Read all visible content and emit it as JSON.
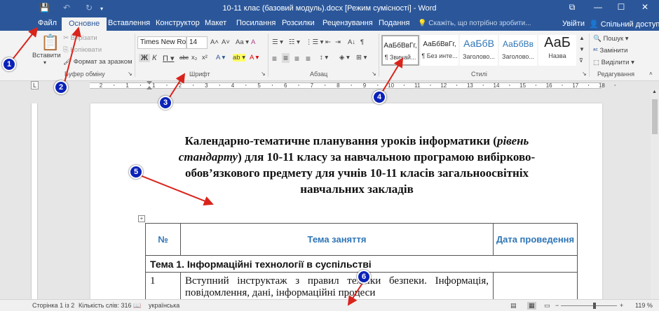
{
  "titlebar": {
    "title": "10-11 клас (базовий модуль).docx [Режим сумісності] - Word",
    "qat": [
      "💾",
      "↶",
      "↻"
    ],
    "window_buttons": [
      "⧉",
      "—",
      "☐",
      "✕"
    ]
  },
  "tabs": {
    "items": [
      "Файл",
      "Основне",
      "Вставлення",
      "Конструктор",
      "Макет",
      "Посилання",
      "Розсилки",
      "Рецензування",
      "Подання"
    ],
    "active": "Основне",
    "tell_me": "Скажіть, що потрібно зробити...",
    "signin": "Увійти",
    "share": "Спільний доступ"
  },
  "clipboard": {
    "paste": "Вставити",
    "cut": "Вирізати",
    "copy": "Копіювати",
    "format_painter": "Формат за зразком",
    "label": "Буфер обміну"
  },
  "font": {
    "name": "Times New Ro",
    "size": "14",
    "label": "Шрифт",
    "row1": [
      "A˄",
      "A˅",
      "Aa ▾",
      "A"
    ],
    "row2": [
      "Ж",
      "К",
      "П ▾",
      "abc",
      "x₂",
      "x²",
      "A ▾",
      "ab ▾",
      "A ▾"
    ]
  },
  "paragraph": {
    "label": "Абзац",
    "row1": [
      "☰ ▾",
      "☷ ▾",
      "⋮☰ ▾",
      "⇤",
      "⇥",
      "A↓",
      "¶"
    ],
    "row2": [
      "≡",
      "≡",
      "≡",
      "≡",
      "↕ ▾",
      "◈ ▾",
      "⊞ ▾"
    ]
  },
  "styles": {
    "label": "Стилі",
    "items": [
      {
        "preview": "АаБбВвГг,",
        "name": "¶ Звичай..."
      },
      {
        "preview": "АаБбВвГг,",
        "name": "¶ Без инте..."
      },
      {
        "preview": "АаБбВ",
        "name": "Заголово..."
      },
      {
        "preview": "АаБбВв",
        "name": "Заголово..."
      },
      {
        "preview": "АаБ",
        "name": "Назва"
      }
    ]
  },
  "editing": {
    "label": "Редагування",
    "find": "Пошук",
    "replace": "Замінити",
    "select": "Виділити"
  },
  "ruler": {
    "ticks": [
      "2",
      "1",
      "1",
      "2",
      "3",
      "4",
      "5",
      "6",
      "7",
      "8",
      "9",
      "10",
      "11",
      "12",
      "13",
      "14",
      "15",
      "16",
      "17",
      "18"
    ]
  },
  "document": {
    "heading_part1": "Календарно-тематичне планування уроків інформатики (",
    "heading_italic": "рівень стандарту",
    "heading_part2": ") для 10-11 класу за навчальною програмою вибірково-обов’язкового предмету для учнів 10-11 класів загальноосвітніх навчальних закладів",
    "table": {
      "headers": [
        "№",
        "Тема заняття",
        "Дата проведення"
      ],
      "topic": "Тема 1. Інформаційні технології в суспільстві",
      "row": [
        "1",
        "Вступний інструктаж з правил техніки безпеки. Інформація, повідомлення, дані, інформаційні процеси",
        ""
      ]
    }
  },
  "statusbar": {
    "page": "Сторінка 1 із 2",
    "words": "Кількість слів: 316",
    "language": "українська",
    "zoom": "119 %",
    "zoom_percent": 119
  },
  "annotations": [
    "1",
    "2",
    "3",
    "4",
    "5",
    "6"
  ],
  "colors": {
    "brand": "#2b579a",
    "annotation": "#0b22b8",
    "arrow": "#d9241c",
    "table_header": "#2e75b6"
  }
}
